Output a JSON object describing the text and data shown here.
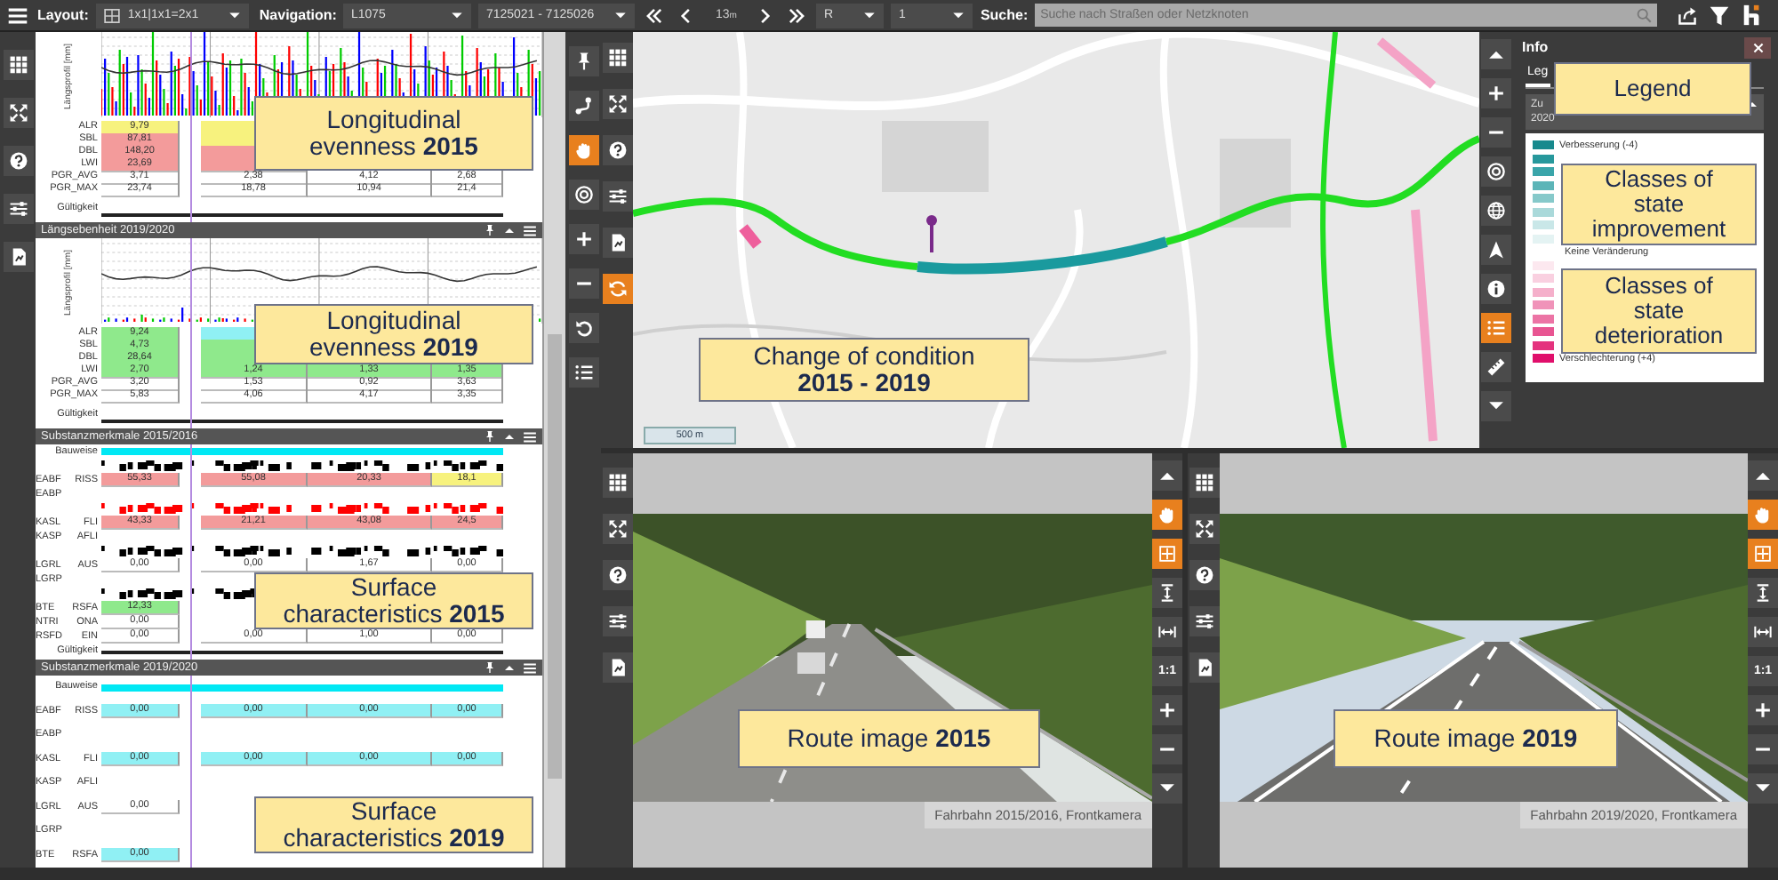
{
  "toolbar": {
    "layout_label": "Layout:",
    "layout_value": "1x1|1x1=2x1",
    "navigation_label": "Navigation:",
    "road": "L1075",
    "section": "7125021 - 7125026",
    "step": "13",
    "step_unit": "m",
    "lane": "R",
    "lane_number": "1",
    "search_label": "Suche:",
    "search_placeholder": "Suche nach Straßen oder Netzknoten"
  },
  "left_panel": {
    "left_rail": [
      {
        "kind": "grid",
        "active": false
      },
      {
        "kind": "expand",
        "active": false
      },
      {
        "kind": "help",
        "active": false
      },
      {
        "kind": "sliders",
        "active": false
      },
      {
        "kind": "export",
        "active": false
      }
    ],
    "right_rail": [
      {
        "kind": "pin",
        "active": false
      },
      {
        "kind": "route",
        "active": false
      },
      {
        "kind": "hand",
        "active": true
      },
      {
        "kind": "target",
        "active": false
      },
      {
        "kind": "plus",
        "active": false
      },
      {
        "kind": "minus",
        "active": false
      },
      {
        "kind": "undo",
        "active": false
      },
      {
        "kind": "list",
        "active": false
      }
    ],
    "panels": [
      {
        "kind": "evenness",
        "y_label": "Längsprofil [mm]",
        "rows": [
          {
            "kind": "values",
            "label": "ALR",
            "cells": [
              {
                "value": "9,79",
                "color": "#f7f27e"
              },
              {
                "color": "#f7f27e"
              }
            ]
          },
          {
            "kind": "values",
            "label": "SBL",
            "cells": [
              {
                "value": "87,81",
                "color": "#f39b9b"
              },
              {
                "color": "#f7f27e"
              }
            ]
          },
          {
            "kind": "values",
            "label": "DBL",
            "cells": [
              {
                "value": "148,20",
                "color": "#f39b9b"
              },
              {
                "color": "#f39b9b"
              }
            ]
          },
          {
            "kind": "values",
            "label": "LWI",
            "cells": [
              {
                "value": "23,69",
                "color": "#f39b9b"
              },
              {
                "color": "#f39b9b"
              }
            ]
          },
          {
            "kind": "values",
            "label": "PGR_AVG",
            "cells": [
              {
                "value": "3,71"
              },
              {
                "value": "2,38"
              },
              {
                "value": "4,12"
              },
              {
                "value": "2,68"
              }
            ]
          },
          {
            "kind": "values",
            "label": "PGR_MAX",
            "cells": [
              {
                "value": "23,74"
              },
              {
                "value": "18,78"
              },
              {
                "value": "10,94"
              },
              {
                "value": "21,4"
              }
            ]
          },
          {
            "kind": "footer",
            "label": "Gültigkeit"
          }
        ],
        "callout": [
          "Longitudinal",
          "evenness **2015**"
        ]
      },
      {
        "kind": "evenness",
        "title": "Längsebenheit 2019/2020",
        "y_label": "Längsprofil [mm]",
        "rows": [
          {
            "kind": "values",
            "label": "ALR",
            "cells": [
              {
                "value": "9,24",
                "color": "#8fe98c"
              },
              {
                "color": "#90f0f4"
              }
            ]
          },
          {
            "kind": "values",
            "label": "SBL",
            "cells": [
              {
                "value": "4,73",
                "color": "#8fe98c"
              },
              {
                "color": "#8fe98c"
              }
            ]
          },
          {
            "kind": "values",
            "label": "DBL",
            "cells": [
              {
                "value": "28,64",
                "color": "#8fe98c"
              },
              {
                "color": "#8fe98c"
              }
            ]
          },
          {
            "kind": "values",
            "label": "LWI",
            "cells": [
              {
                "value": "2,70",
                "color": "#8fe98c"
              },
              {
                "value": "1,24",
                "color": "#8fe98c"
              },
              {
                "value": "1,33",
                "color": "#8fe98c"
              },
              {
                "value": "1,35",
                "color": "#8fe98c"
              }
            ]
          },
          {
            "kind": "values",
            "label": "PGR_AVG",
            "cells": [
              {
                "value": "3,20"
              },
              {
                "value": "1,53"
              },
              {
                "value": "0,92"
              },
              {
                "value": "3,63"
              }
            ]
          },
          {
            "kind": "values",
            "label": "PGR_MAX",
            "cells": [
              {
                "value": "5,83"
              },
              {
                "value": "4,06"
              },
              {
                "value": "4,17"
              },
              {
                "value": "3,35"
              }
            ]
          },
          {
            "kind": "footer",
            "label": "Gültigkeit"
          }
        ],
        "callout": [
          "Longitudinal",
          "evenness **2019**"
        ]
      },
      {
        "kind": "substance",
        "title": "Substanzmerkmale 2015/2016",
        "rows": [
          {
            "kind": "strip",
            "label": "Bauweise",
            "color": "#00e8f4"
          },
          {
            "kind": "pattern",
            "color": "#000000"
          },
          {
            "kind": "values",
            "group": "EABF",
            "label": "RISS",
            "cells": [
              {
                "value": "55,33",
                "color": "#f39b9b"
              },
              {
                "value": "55,08",
                "color": "#f39b9b"
              },
              {
                "value": "20,33",
                "color": "#f39b9b"
              },
              {
                "value": "18,1",
                "color": "#f7f27e"
              }
            ]
          },
          {
            "kind": "values",
            "group": "EABP"
          },
          {
            "kind": "pattern",
            "color": "#ff0000"
          },
          {
            "kind": "values",
            "group": "KASL",
            "label": "FLI",
            "cells": [
              {
                "value": "43,33",
                "color": "#f39b9b"
              },
              {
                "value": "21,21",
                "color": "#f39b9b"
              },
              {
                "value": "43,08",
                "color": "#f39b9b"
              },
              {
                "value": "24,5",
                "color": "#f39b9b"
              }
            ]
          },
          {
            "kind": "values",
            "group": "KASP",
            "label": "AFLI"
          },
          {
            "kind": "pattern",
            "color": "#000000"
          },
          {
            "kind": "values",
            "group": "LGRL",
            "label": "AUS",
            "cells": [
              {
                "value": "0,00"
              },
              {
                "value": "0,00"
              },
              {
                "value": "1,67"
              },
              {
                "value": "0,00"
              }
            ]
          },
          {
            "kind": "values",
            "group": "LGRP"
          },
          {
            "kind": "pattern",
            "color": "#000000"
          },
          {
            "kind": "values",
            "group": "BTE",
            "label": "RSFA",
            "cells": [
              {
                "value": "12,33",
                "color": "#8fe98c"
              }
            ]
          },
          {
            "kind": "values",
            "group": "NTRI",
            "label": "ONA",
            "cells": [
              {
                "value": "0,00"
              }
            ]
          },
          {
            "kind": "values",
            "group": "RSFD",
            "label": "EIN",
            "cells": [
              {
                "value": "0,00"
              },
              {
                "value": "0,00"
              },
              {
                "value": "1,00"
              },
              {
                "value": "0,00"
              }
            ]
          },
          {
            "kind": "footer",
            "label": "Gültigkeit"
          }
        ],
        "callout": [
          "Surface",
          "characteristics **2015**"
        ]
      },
      {
        "kind": "substance",
        "title": "Substanzmerkmale 2019/2020",
        "rows": [
          {
            "kind": "strip",
            "label": "Bauweise",
            "color": "#00e8f4"
          },
          {
            "kind": "values",
            "group": "EABF",
            "label": "RISS",
            "cells": [
              {
                "value": "0,00",
                "color": "#90f0f4"
              },
              {
                "value": "0,00",
                "color": "#90f0f4"
              },
              {
                "value": "0,00",
                "color": "#90f0f4"
              },
              {
                "value": "0,00",
                "color": "#90f0f4"
              }
            ]
          },
          {
            "kind": "values",
            "group": "EABP"
          },
          {
            "kind": "values",
            "group": "KASL",
            "label": "FLI",
            "cells": [
              {
                "value": "0,00",
                "color": "#90f0f4"
              },
              {
                "value": "0,00",
                "color": "#90f0f4"
              },
              {
                "value": "0,00",
                "color": "#90f0f4"
              },
              {
                "value": "0,00",
                "color": "#90f0f4"
              }
            ]
          },
          {
            "kind": "values",
            "group": "KASP",
            "label": "AFLI"
          },
          {
            "kind": "values",
            "group": "LGRL",
            "label": "AUS",
            "cells": [
              {
                "value": "0,00"
              }
            ]
          },
          {
            "kind": "values",
            "group": "LGRP"
          },
          {
            "kind": "values",
            "group": "BTE",
            "label": "RSFA",
            "cells": [
              {
                "value": "0,00",
                "color": "#90f0f4"
              }
            ]
          }
        ],
        "callout": [
          "Surface",
          "characteristics **2019**"
        ]
      }
    ]
  },
  "map": {
    "left_rail": [
      {
        "kind": "grid",
        "active": false
      },
      {
        "kind": "expand",
        "active": false
      },
      {
        "kind": "help",
        "active": false
      },
      {
        "kind": "sliders",
        "active": false
      },
      {
        "kind": "export",
        "active": false
      },
      {
        "kind": "sync",
        "active": true
      }
    ],
    "right_rail": [
      {
        "kind": "up",
        "active": false
      },
      {
        "kind": "plus",
        "active": false
      },
      {
        "kind": "minus",
        "active": false
      },
      {
        "kind": "target",
        "active": false
      },
      {
        "kind": "globe",
        "active": false
      },
      {
        "kind": "north",
        "active": false
      },
      {
        "kind": "info",
        "active": false
      },
      {
        "kind": "list",
        "active": true
      },
      {
        "kind": "ruler",
        "active": false
      },
      {
        "kind": "down",
        "active": false
      }
    ],
    "scale": "500 m",
    "callout": [
      "Change of condition",
      "**2015 - 2019**"
    ]
  },
  "info": {
    "title": "Info",
    "tabs": [
      {
        "label": "Leg",
        "selected": true
      }
    ],
    "dropdown_lines": [
      "Zu",
      "2020"
    ],
    "legend": [
      {
        "kind": "swatch",
        "color": "#17898d",
        "label": "Verbesserung (-4)"
      },
      {
        "kind": "swatch",
        "color": "#27989c"
      },
      {
        "kind": "swatch",
        "color": "#3aa5aa"
      },
      {
        "kind": "swatch",
        "color": "#5cb5b8"
      },
      {
        "kind": "swatch",
        "color": "#86c9ca"
      },
      {
        "kind": "swatch",
        "color": "#aad9da"
      },
      {
        "kind": "swatch",
        "color": "#c9e7e8"
      },
      {
        "kind": "swatch",
        "color": "#e4f3f3"
      },
      {
        "kind": "text",
        "label": "Keine Veränderung"
      },
      {
        "kind": "swatch",
        "color": "#fce8ef"
      },
      {
        "kind": "swatch",
        "color": "#f9d0e0"
      },
      {
        "kind": "swatch",
        "color": "#f5b0cb"
      },
      {
        "kind": "swatch",
        "color": "#f093b9"
      },
      {
        "kind": "swatch",
        "color": "#ec74a5"
      },
      {
        "kind": "swatch",
        "color": "#e85592"
      },
      {
        "kind": "swatch",
        "color": "#e4337e"
      },
      {
        "kind": "swatch",
        "color": "#e00f6b",
        "label": "Verschlechterung (+4)"
      }
    ],
    "callouts": [
      [
        "Legend"
      ],
      [
        "Classes of",
        "state",
        "improvement"
      ],
      [
        "Classes of",
        "state",
        "deterioration"
      ]
    ]
  },
  "viewers": [
    {
      "left_rail": [
        {
          "kind": "grid",
          "active": false
        },
        {
          "kind": "expand",
          "active": false
        },
        {
          "kind": "help",
          "active": false
        },
        {
          "kind": "sliders",
          "active": false
        },
        {
          "kind": "export",
          "active": false
        }
      ],
      "right_rail": [
        {
          "kind": "up",
          "active": false
        },
        {
          "kind": "hand",
          "active": true
        },
        {
          "kind": "fit",
          "active": true
        },
        {
          "kind": "fitheight",
          "active": false
        },
        {
          "kind": "fitwidth",
          "active": false
        },
        {
          "kind": "text",
          "text": "1:1",
          "active": false
        },
        {
          "kind": "plus",
          "active": false
        },
        {
          "kind": "minus",
          "active": false
        },
        {
          "kind": "down",
          "active": false
        }
      ],
      "caption": "Fahrbahn 2015/2016, Frontkamera",
      "callout": [
        "Route image **2015**"
      ]
    },
    {
      "left_rail": [
        {
          "kind": "grid",
          "active": false
        },
        {
          "kind": "expand",
          "active": false
        },
        {
          "kind": "help",
          "active": false
        },
        {
          "kind": "sliders",
          "active": false
        },
        {
          "kind": "export",
          "active": false
        }
      ],
      "right_rail": [
        {
          "kind": "up",
          "active": false
        },
        {
          "kind": "hand",
          "active": true
        },
        {
          "kind": "fit",
          "active": true
        },
        {
          "kind": "fitheight",
          "active": false
        },
        {
          "kind": "fitwidth",
          "active": false
        },
        {
          "kind": "text",
          "text": "1:1",
          "active": false
        },
        {
          "kind": "plus",
          "active": false
        },
        {
          "kind": "minus",
          "active": false
        },
        {
          "kind": "down",
          "active": false
        }
      ],
      "caption": "Fahrbahn 2019/2020, Frontkamera",
      "callout": [
        "Route image **2019**"
      ]
    }
  ]
}
